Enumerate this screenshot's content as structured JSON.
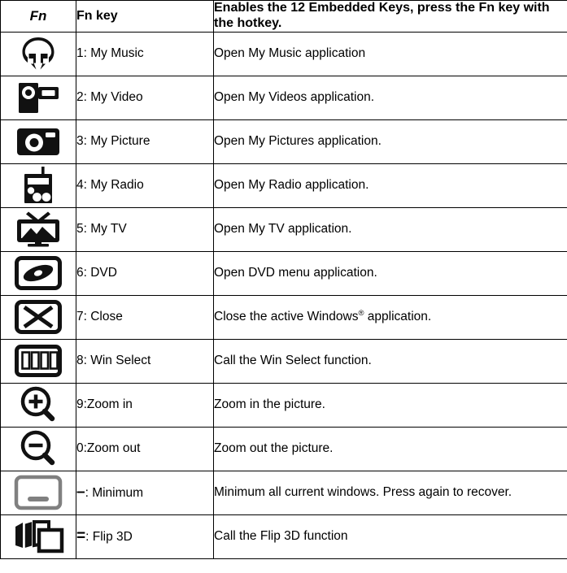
{
  "header": {
    "fn_label": "Fn",
    "key_label": "Fn key",
    "description_label": "Enables the 12 Embedded Keys, press the Fn key with the hotkey."
  },
  "colors": {
    "icon_black": "#111111",
    "icon_gray": "#808080",
    "border": "#000000",
    "background": "#ffffff"
  },
  "rows": [
    {
      "icon": "headphones-music-icon",
      "key": "1: My Music",
      "description": "Open My Music application"
    },
    {
      "icon": "video-camera-icon",
      "key": "2: My Video",
      "description": "Open My Videos application."
    },
    {
      "icon": "photo-camera-icon",
      "key": "3: My Picture",
      "description": "Open My Pictures application."
    },
    {
      "icon": "radio-icon",
      "key": "4: My Radio",
      "description": "Open My Radio application."
    },
    {
      "icon": "television-icon",
      "key": "5: My TV",
      "description": "Open My TV application."
    },
    {
      "icon": "dvd-disc-icon",
      "key": "6: DVD",
      "description": "Open DVD menu application."
    },
    {
      "icon": "close-x-icon",
      "key": "7: Close",
      "description_prefix": "Close the active Windows",
      "description_sup": "®",
      "description_suffix": " application.",
      "description": "Close the active Windows® application."
    },
    {
      "icon": "win-select-icon",
      "key": "8: Win Select",
      "description": "Call the Win Select function."
    },
    {
      "icon": "zoom-in-icon",
      "key": "9:Zoom in",
      "description": "Zoom in the picture."
    },
    {
      "icon": "zoom-out-icon",
      "key": "0:Zoom out",
      "description": "Zoom out the picture."
    },
    {
      "icon": "minimize-window-icon",
      "key_symbol": "–",
      "key_rest": ": Minimum",
      "key": "–: Minimum",
      "description": "Minimum all current windows. Press again to recover."
    },
    {
      "icon": "flip-3d-icon",
      "key_symbol": "=",
      "key_rest": ": Flip 3D",
      "key": "=: Flip 3D",
      "description": "Call the Flip 3D function"
    }
  ]
}
